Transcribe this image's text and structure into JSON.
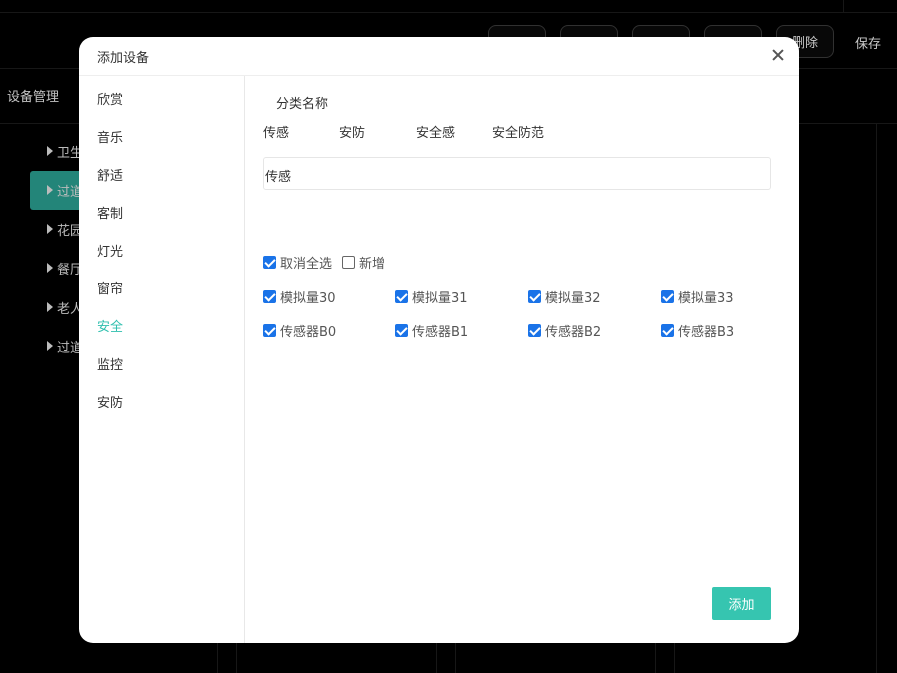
{
  "background": {
    "page_title": "设备管理",
    "toolbar": {
      "btn_1": "",
      "btn_2": "",
      "btn_3": "",
      "btn_4": "",
      "delete_label": "删除",
      "save_label": "保存"
    },
    "tree": [
      {
        "label": "卫生"
      },
      {
        "label": "过道"
      },
      {
        "label": "花园"
      },
      {
        "label": "餐厅"
      },
      {
        "label": "老人"
      },
      {
        "label": "过道"
      }
    ]
  },
  "dialog": {
    "title": "添加设备",
    "categories": [
      "欣赏",
      "音乐",
      "舒适",
      "客制",
      "灯光",
      "窗帘",
      "安全",
      "监控",
      "安防"
    ],
    "active_category": "安全",
    "category_name_label": "分类名称",
    "category_tags": [
      "传感",
      "安防",
      "安全感",
      "安全防范"
    ],
    "name_input_value": "传感",
    "select_all": {
      "label": "取消全选",
      "checked": true
    },
    "new_item": {
      "label": "新增",
      "checked": false
    },
    "devices": [
      {
        "label": "模拟量30",
        "checked": true
      },
      {
        "label": "模拟量31",
        "checked": true
      },
      {
        "label": "模拟量32",
        "checked": true
      },
      {
        "label": "模拟量33",
        "checked": true
      },
      {
        "label": "传感器B0",
        "checked": true
      },
      {
        "label": "传感器B1",
        "checked": true
      },
      {
        "label": "传感器B2",
        "checked": true
      },
      {
        "label": "传感器B3",
        "checked": true
      }
    ],
    "add_button_label": "添加"
  },
  "colors": {
    "accent": "#36c5b0",
    "active_text": "#2fbfae",
    "checkbox": "#1a73e8",
    "tree_active_bg": "#2a9d8f"
  }
}
